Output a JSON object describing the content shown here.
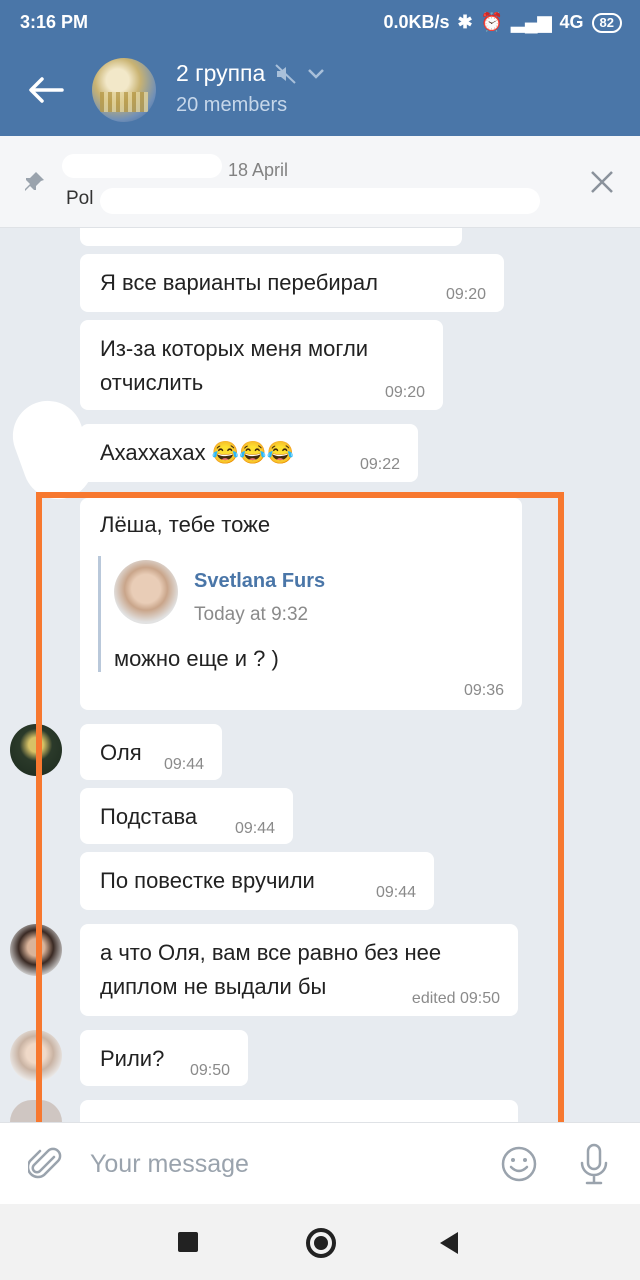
{
  "status_bar": {
    "time": "3:16 PM",
    "network_speed": "0.0KB/s",
    "network_type": "4G",
    "battery": "82"
  },
  "header": {
    "title": "2 группа",
    "subtitle": "20 members",
    "color": "#4a76a8"
  },
  "pinned": {
    "date": "18 April",
    "text_fragment": "Pol"
  },
  "messages": [
    {
      "text": "Я все варианты перебирал",
      "time": "09:20"
    },
    {
      "line1": "Из-за которых меня могли",
      "line2": "отчислить",
      "time": "09:20"
    },
    {
      "text": "Ахаххахах 😂😂😂",
      "time": "09:22"
    },
    {
      "text": "Лёша, тебе тоже",
      "reply": {
        "author": "Svetlana Furs",
        "time": "Today at 9:32",
        "text": "можно еще и ? )"
      },
      "time": "09:36"
    },
    {
      "text": "Оля",
      "time": "09:44"
    },
    {
      "text": "Подстава",
      "time": "09:44"
    },
    {
      "text": "По повестке вручили",
      "time": "09:44"
    },
    {
      "line1": "а что Оля, вам все равно без нее",
      "line2": "диплом не выдали бы",
      "time": "edited 09:50"
    },
    {
      "text": "Рили?",
      "time": "09:50"
    }
  ],
  "composer": {
    "placeholder": "Your message"
  },
  "highlight_color": "#f7782f"
}
